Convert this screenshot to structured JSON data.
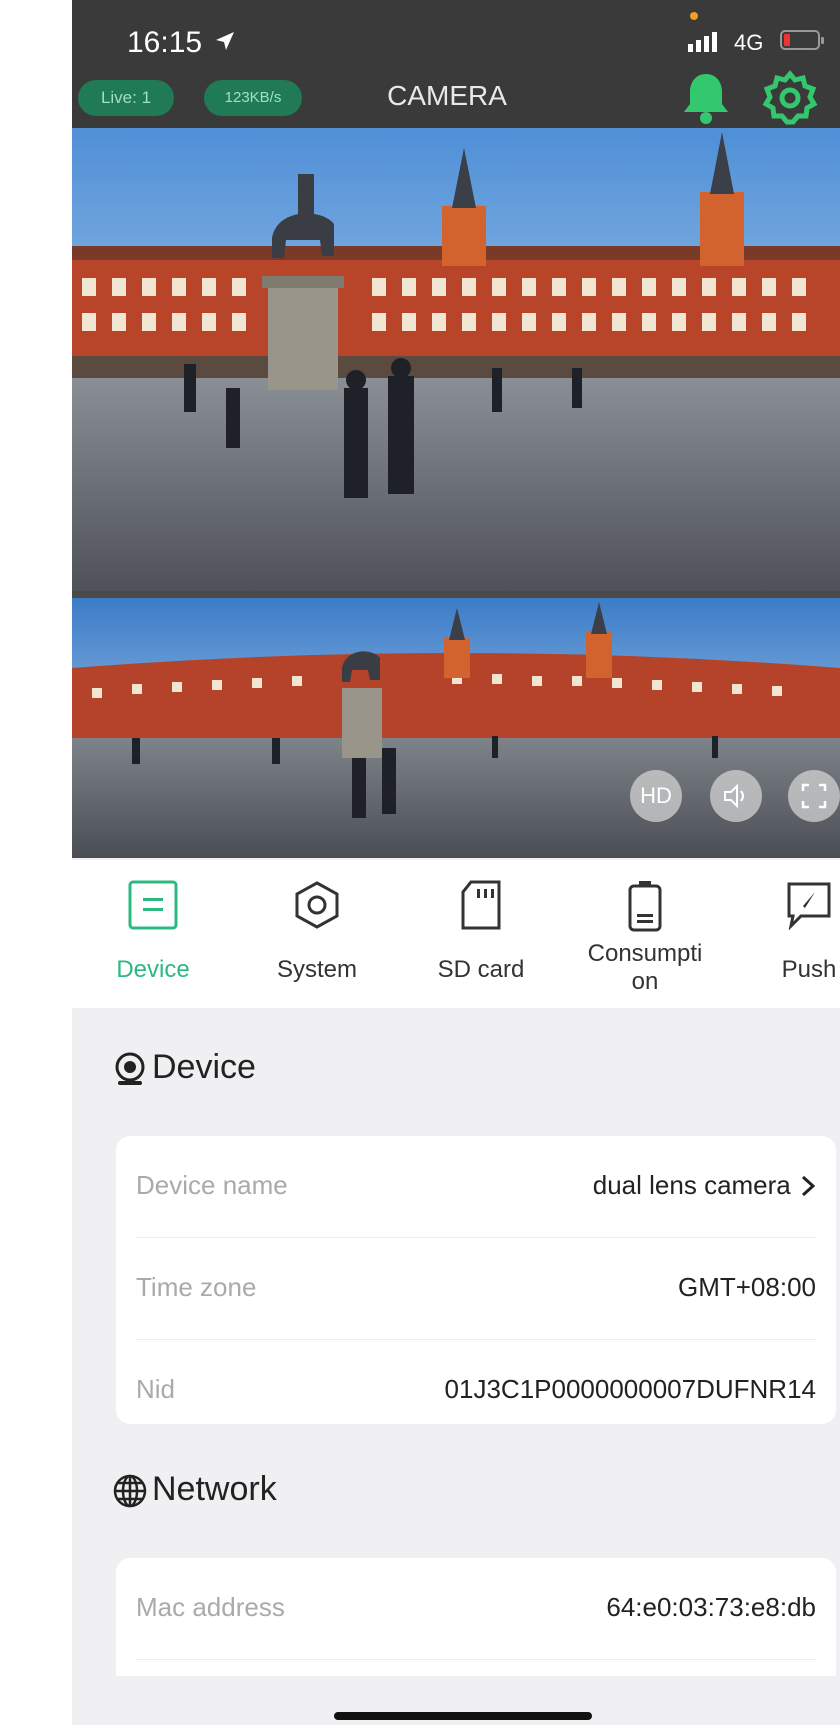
{
  "status_bar": {
    "time": "16:15",
    "network": "4G"
  },
  "header": {
    "title": "CAMERA",
    "live_badge": "Live: 1",
    "speed_badge": "123KB/s",
    "accent_color": "#2bb980"
  },
  "video_controls": {
    "hd_label": "HD"
  },
  "tabs": [
    {
      "label": "Device",
      "icon": "device-list-icon",
      "active": true
    },
    {
      "label": "System",
      "icon": "hexagon-settings-icon",
      "active": false
    },
    {
      "label": "SD card",
      "icon": "sd-card-icon",
      "active": false
    },
    {
      "label": "Consumpti\non",
      "icon": "battery-icon",
      "active": false
    },
    {
      "label": "Push",
      "icon": "push-message-icon",
      "active": false
    }
  ],
  "device_section": {
    "title": "Device",
    "rows": [
      {
        "label": "Device name",
        "value": "dual lens camera"
      },
      {
        "label": "Time zone",
        "value": "GMT+08:00"
      },
      {
        "label": "Nid",
        "value": "01J3C1P0000000007DUFNR14"
      }
    ]
  },
  "network_section": {
    "title": "Network",
    "rows": [
      {
        "label": "Mac address",
        "value": "64:e0:03:73:e8:db"
      }
    ]
  }
}
